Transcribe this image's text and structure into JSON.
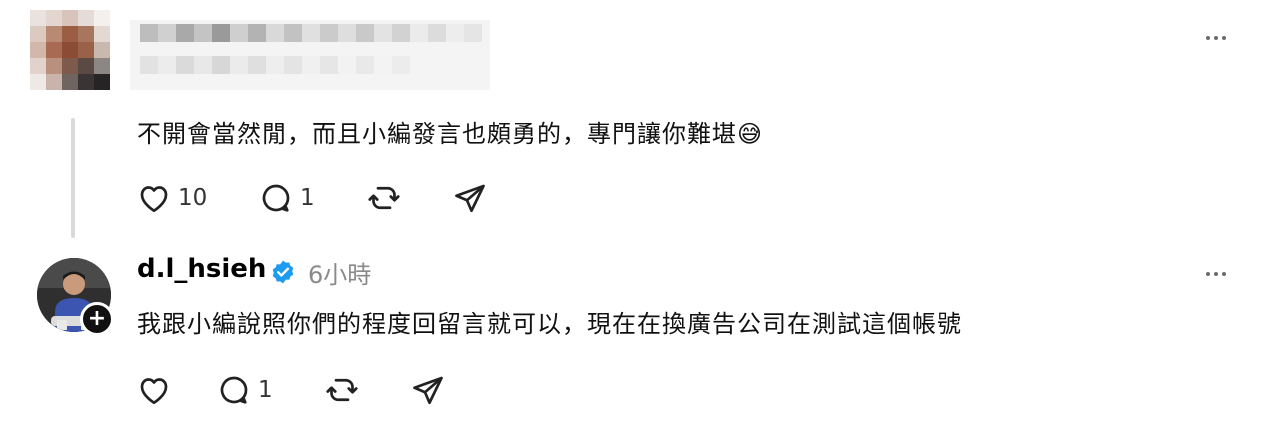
{
  "post1": {
    "text": "不開會當然閒，而且小編發言也頗勇的，專門讓你難堪😅",
    "likes": "10",
    "replies": "1",
    "icons": [
      "heart-icon",
      "comment-icon",
      "repost-icon",
      "share-icon",
      "more-icon"
    ]
  },
  "post2": {
    "username": "d.l_hsieh",
    "time": "6小時",
    "text": "我跟小編說照你們的程度回留言就可以，現在在換廣告公司在測試這個帳號",
    "likes": "",
    "replies": "1",
    "icons": [
      "heart-icon",
      "comment-icon",
      "repost-icon",
      "share-icon",
      "more-icon",
      "verified-icon",
      "follow-plus-icon"
    ]
  },
  "colors": {
    "verified": "#1d9bf0",
    "muted": "#8a8a8a",
    "thread_line": "#d9d9d9"
  }
}
